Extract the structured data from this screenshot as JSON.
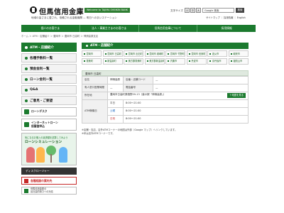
{
  "header": {
    "logo_text": "但馬信用金庫",
    "logo_badge": "Welcome to TAJIMA SHINKIN BANK",
    "tagline": "地域の皆さまに愛され、信頼される金融機関 — 明日へのまいステーション",
    "font_size_label": "文字サイズ",
    "font_size_buttons": [
      "小",
      "中",
      "大"
    ],
    "search_placeholder": "Google 検索",
    "search_button": "検索",
    "header_links": "サイトマップ ｜ 採用情報 ｜ English"
  },
  "globalnav": {
    "items": [
      "個人のお客さま",
      "法人・事業主さまのお客さま",
      "但馬信用金庫について",
      "採用情報"
    ]
  },
  "breadcrumb": "ホーム ＞ ATM・店舗紹介 ＞ 豊岡市 ＞ 豊岡市 日高町 ＞ 神鍋高原支店",
  "sidebar": {
    "items": [
      {
        "label": "ATM・店舗紹介",
        "active": true
      },
      {
        "label": "各種手数料一覧",
        "active": false
      },
      {
        "label": "預金金利一覧",
        "active": false
      },
      {
        "label": "ローン金利一覧",
        "active": false
      },
      {
        "label": "Q&A",
        "active": false
      },
      {
        "label": "ご意見・ご要望",
        "active": false
      }
    ],
    "banner_loan": "ローンデスク",
    "banner_internet": "インターネットローン\n仮審査申込",
    "simulation_top": "気になるお借入の返済額を試算してみよう",
    "simulation_title": "ローンシミュレーション",
    "disclosure": "ディスクロージャー",
    "red_banner": "各種相談の案内先",
    "small_banner": "但馬信用金庫の\n反社会的勢力への対応"
  },
  "main": {
    "title": "ATM・店舗紹介",
    "branches": [
      "豊岡市",
      "豊岡市 日高町",
      "豊岡市 出石町",
      "豊岡市 城崎町",
      "豊岡市 竹野町",
      "豊岡市 但東町",
      "養父市",
      "朝来市",
      "香美町",
      "新温泉町",
      "美方郡香美町",
      "美方郡新温泉町",
      "宍粟市",
      "丹波市",
      "京丹後市",
      "福知山市"
    ],
    "detail_head": "豊岡市 日高町",
    "detail": {
      "name_label": "店名",
      "name_value": "神鍋高原",
      "code_label": "店番・店舗コード",
      "code_value": "—",
      "staff_label": "有人窓口営業時間",
      "staff_value": "—",
      "tel_label": "電話番号",
      "tel_value": "—",
      "address_label": "所在地",
      "address_value": "豊岡市日高町栗栖野59-13（道の駅「神鍋高原」）",
      "map_button": "＋地図を見る",
      "atm_label": "ATM稼働日",
      "atm_rows": [
        {
          "day": "平日",
          "time": "8:00〜21:00",
          "cls": ""
        },
        {
          "day": "土曜",
          "time": "8:00〜21:00",
          "cls": "day-sat"
        },
        {
          "day": "日祝",
          "time": "8:00〜21:00",
          "cls": "day-sun"
        }
      ]
    },
    "notes": [
      "※店舗・支店、店外ATMコーナーの地図は外部（Google マップ）へリンクしています。",
      "※印は店外ATMコーナーです。"
    ]
  },
  "colors": {
    "brand_green": "#1b7a2e",
    "accent_red": "#c62828"
  }
}
